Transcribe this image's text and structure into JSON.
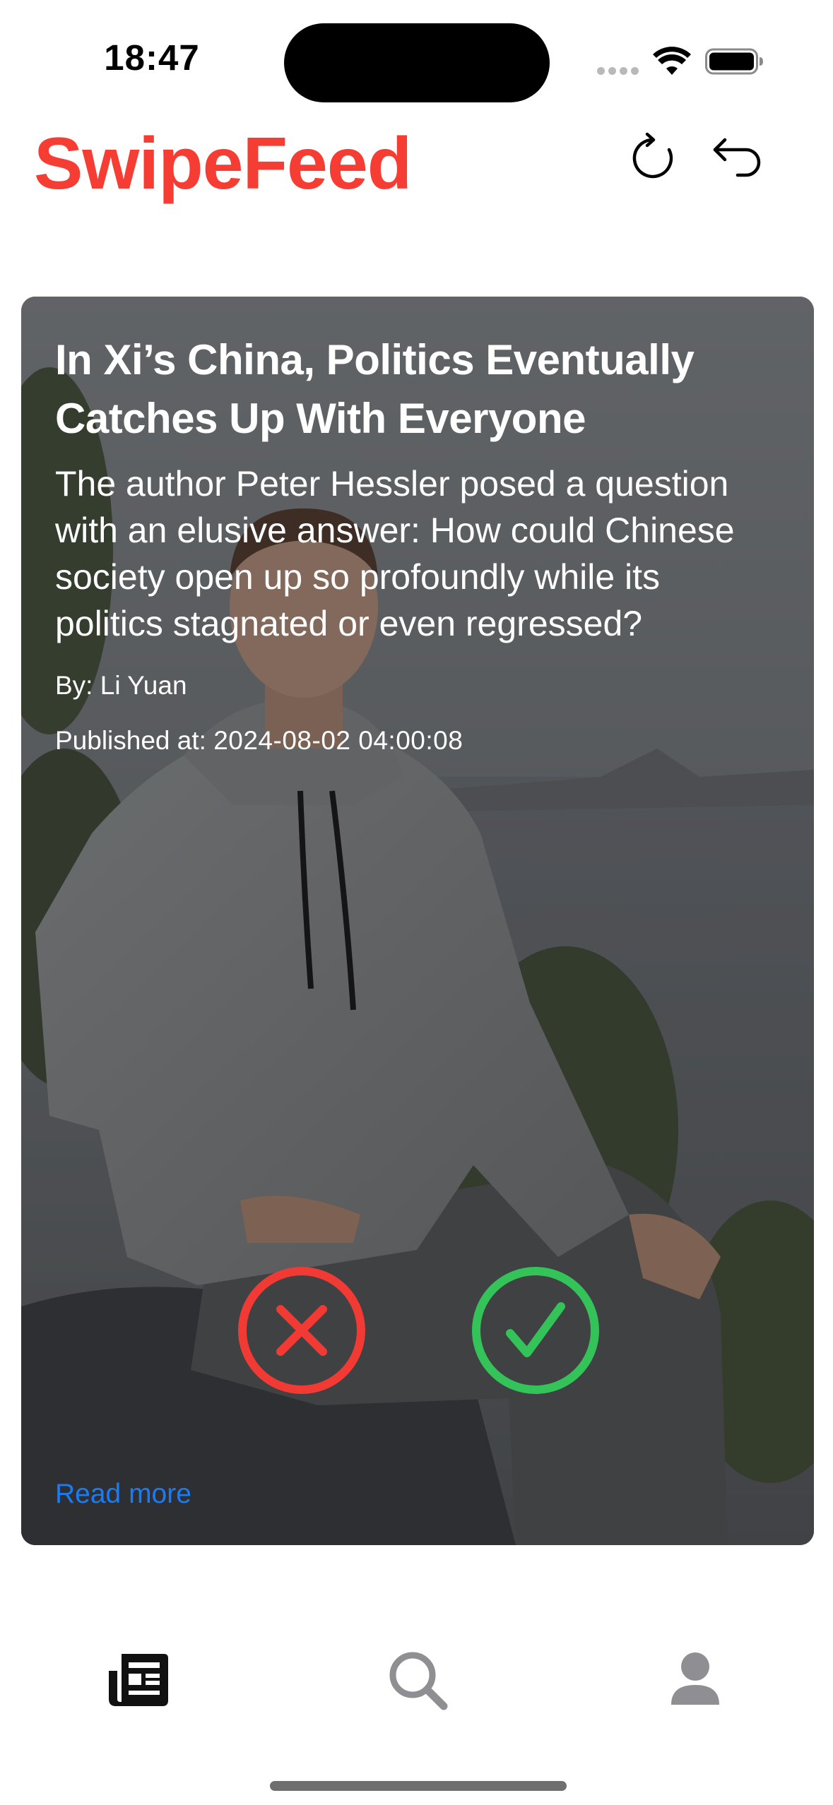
{
  "status_bar": {
    "time": "18:47"
  },
  "header": {
    "app_title": "SwipeFeed",
    "icons": [
      "refresh-icon",
      "undo-icon"
    ]
  },
  "article": {
    "title": "In Xi’s China, Politics Eventually Catches Up With Everyone",
    "summary": "The author Peter Hessler posed a question with an elusive answer: How could Chinese society open up so profoundly while its politics stagnated or even regressed?",
    "author_label": "By:",
    "author": "Li Yuan",
    "published_label": "Published at:",
    "published_at": "2024-08-02 04:00:08",
    "read_more": "Read more",
    "actions": {
      "reject_icon": "x-circle-icon",
      "accept_icon": "checkmark-circle-icon"
    }
  },
  "tab_bar": {
    "tabs": [
      {
        "icon": "newspaper-icon",
        "selected": true
      },
      {
        "icon": "search-icon",
        "selected": false
      },
      {
        "icon": "person-icon",
        "selected": false
      }
    ]
  },
  "colors": {
    "brand": "#f63d33",
    "reject": "#f03a33",
    "accept": "#33c358",
    "link": "#1a7cf5",
    "tab_selected": "#111111",
    "tab_unselected": "#8e8e93"
  }
}
